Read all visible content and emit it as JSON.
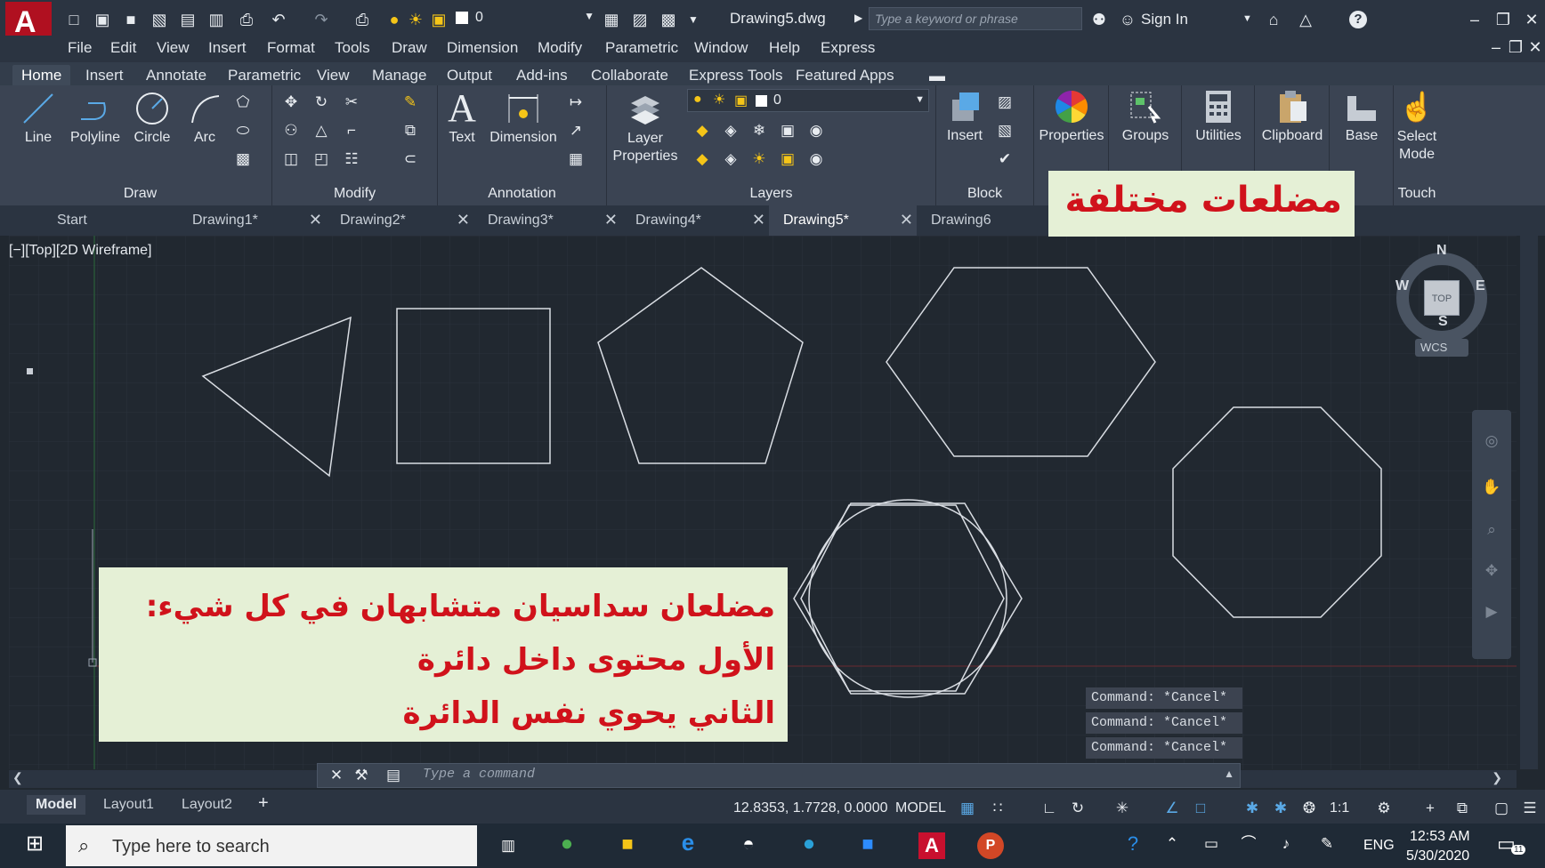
{
  "window": {
    "title": "Drawing5.dwg",
    "search_placeholder": "Type a keyword or phrase",
    "sign_in": "Sign In",
    "layer_value": "0"
  },
  "menubar": [
    "File",
    "Edit",
    "View",
    "Insert",
    "Format",
    "Tools",
    "Draw",
    "Dimension",
    "Modify",
    "Parametric",
    "Window",
    "Help",
    "Express"
  ],
  "ribbon_tabs": [
    "Home",
    "Insert",
    "Annotate",
    "Parametric",
    "View",
    "Manage",
    "Output",
    "Add-ins",
    "Collaborate",
    "Express Tools",
    "Featured Apps"
  ],
  "ribbon": {
    "draw": {
      "label": "Draw",
      "buttons": [
        "Line",
        "Polyline",
        "Circle",
        "Arc"
      ]
    },
    "modify": {
      "label": "Modify"
    },
    "annotation": {
      "label": "Annotation",
      "buttons": [
        "Text",
        "Dimension"
      ]
    },
    "layers": {
      "label": "Layers",
      "layer_properties": "Layer Properties",
      "layer_value": "0"
    },
    "block": {
      "label": "Block",
      "insert": "Insert"
    },
    "properties": "Properties",
    "groups": "Groups",
    "utilities": "Utilities",
    "clipboard": "Clipboard",
    "base": "Base",
    "select_mode": "Select Mode",
    "touch": "Touch"
  },
  "doc_tabs": [
    "Start",
    "Drawing1*",
    "Drawing2*",
    "Drawing3*",
    "Drawing4*",
    "Drawing5*",
    "Drawing6"
  ],
  "active_doc_tab": "Drawing5*",
  "viewport_label": "[−][Top][2D Wireframe]",
  "viewcube": {
    "n": "N",
    "s": "S",
    "e": "E",
    "w": "W",
    "face": "TOP",
    "wcs": "WCS"
  },
  "overlays": {
    "top_right": "مضلعات مختلفة",
    "bottom_lines": [
      "مضلعان سداسيان متشابهان في كل شيء:",
      "الأول محتوى داخل دائرة",
      "الثاني يحوي نفس الدائرة"
    ]
  },
  "command_history": [
    "Command: *Cancel*",
    "Command: *Cancel*",
    "Command: *Cancel*"
  ],
  "command_placeholder": "Type a command",
  "layout_tabs": [
    "Model",
    "Layout1",
    "Layout2"
  ],
  "status": {
    "coords": "12.8353, 1.7728, 0.0000",
    "mode": "MODEL",
    "scale": "1:1"
  },
  "taskbar": {
    "search_placeholder": "Type here to search",
    "lang": "ENG",
    "time": "12:53 AM",
    "date": "5/30/2020",
    "notif": "11"
  },
  "colors": {
    "canvas": "#212830",
    "linework": "#d9dde3",
    "overlay_bg": "#e5f0d6",
    "overlay_text": "#d0121b",
    "accent": "#c8102e"
  }
}
